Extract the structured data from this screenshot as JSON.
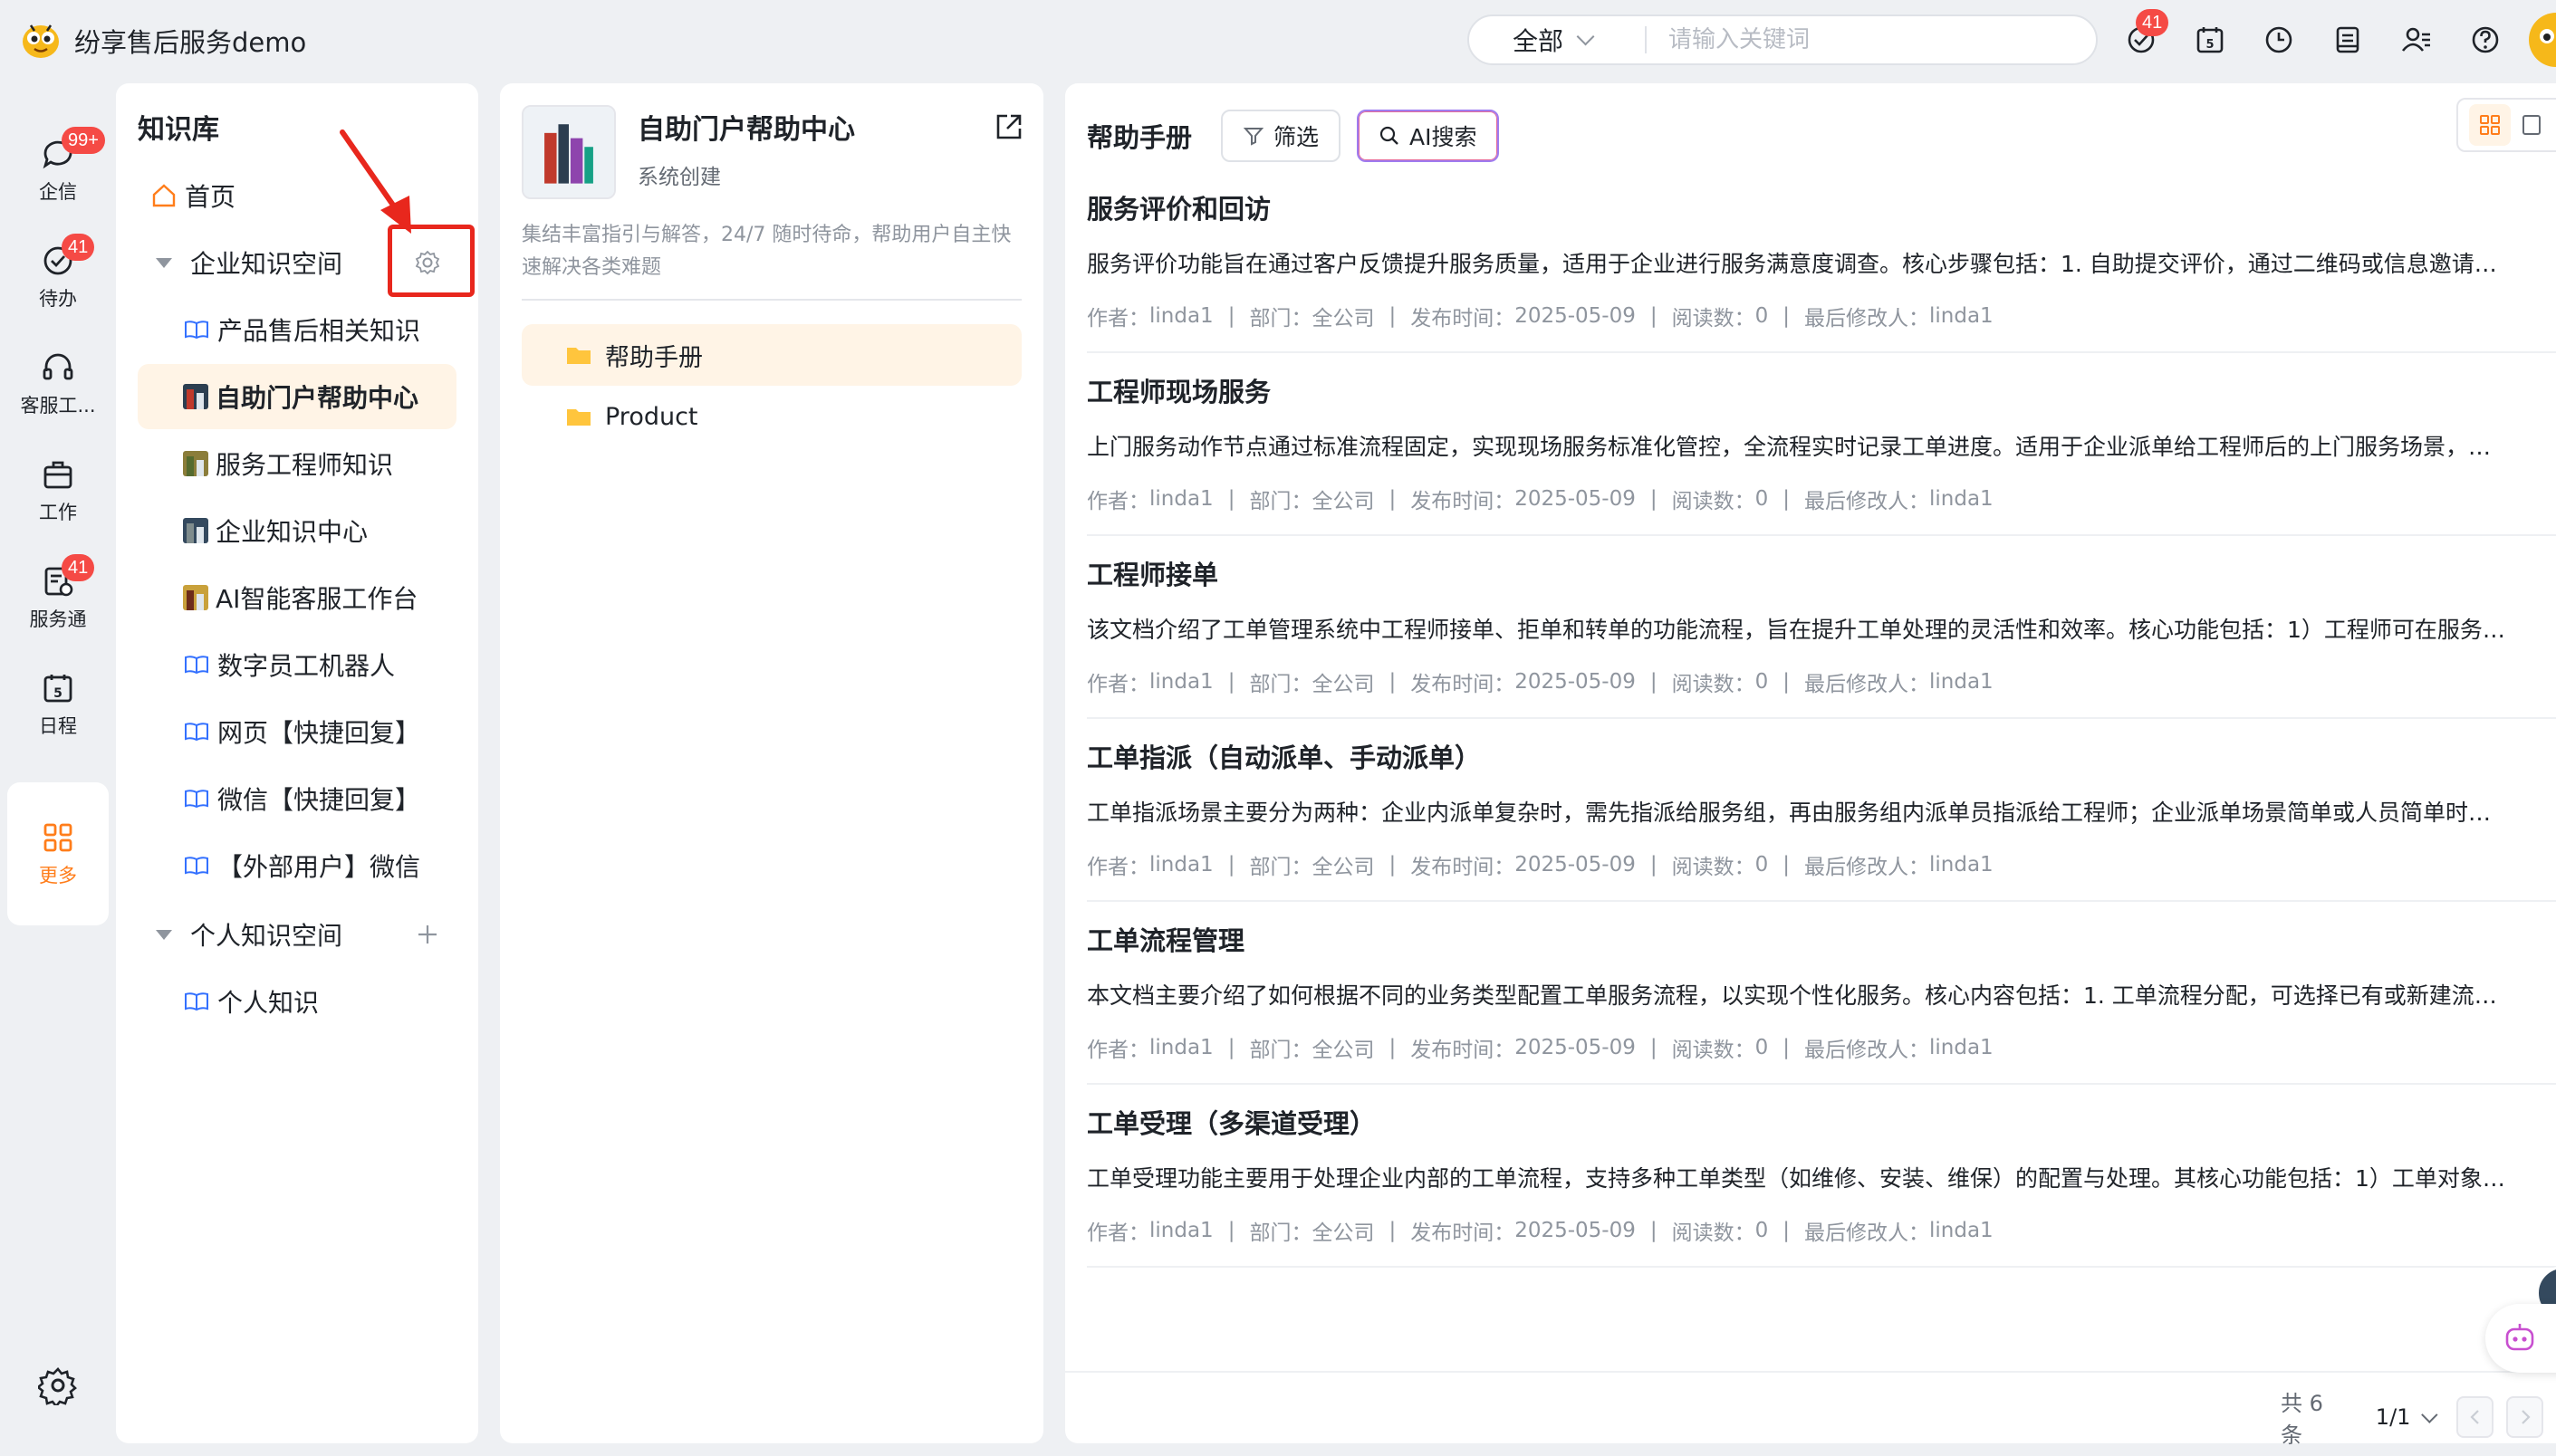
{
  "app": {
    "title": "纷享售后服务demo"
  },
  "search": {
    "scope": "全部",
    "placeholder": "请输入关键词"
  },
  "top_icons": [
    {
      "name": "todo-check-icon",
      "badge": "41"
    },
    {
      "name": "calendar-icon",
      "label": "5"
    },
    {
      "name": "clock-icon"
    },
    {
      "name": "report-icon"
    },
    {
      "name": "contacts-icon"
    },
    {
      "name": "help-icon"
    }
  ],
  "rail": {
    "items": [
      {
        "id": "qixin",
        "label": "企信",
        "badge": "99+"
      },
      {
        "id": "todo",
        "label": "待办",
        "badge": "41"
      },
      {
        "id": "service-desk",
        "label": "客服工..."
      },
      {
        "id": "work",
        "label": "工作"
      },
      {
        "id": "service-pass",
        "label": "服务通",
        "badge": "41"
      },
      {
        "id": "schedule",
        "label": "日程",
        "calendar_day": "5"
      },
      {
        "id": "more",
        "label": "更多"
      }
    ]
  },
  "tree": {
    "title": "知识库",
    "home": "首页",
    "enterprise_space": "企业知识空间",
    "enterprise_items": [
      "产品售后相关知识",
      "自助门户帮助中心",
      "服务工程师知识",
      "企业知识中心",
      "AI智能客服工作台",
      "数字员工机器人",
      "网页【快捷回复】",
      "微信【快捷回复】",
      "【外部用户】微信"
    ],
    "personal_space": "个人知识空间",
    "personal_items": [
      "个人知识"
    ]
  },
  "space": {
    "name": "自助门户帮助中心",
    "creator": "系统创建",
    "description": "集结丰富指引与解答，24/7 随时待命，帮助用户自主快速解决各类难题",
    "folders": [
      "帮助手册",
      "Product"
    ]
  },
  "docs": {
    "title": "帮助手册",
    "filter_label": "筛选",
    "ai_search_label": "AI搜索",
    "meta_labels": {
      "author": "作者：",
      "dept": "部门：",
      "published": "发布时间：",
      "reads": "阅读数：",
      "modifier": "最后修改人："
    },
    "items": [
      {
        "title": "服务评价和回访",
        "summary": "服务评价功能旨在通过客户反馈提升服务质量，适用于企业进行服务满意度调查。核心步骤包括：1. 自助提交评价，通过二维码或信息邀请…",
        "author": "linda1",
        "dept": "全公司",
        "published": "2025-05-09",
        "reads": "0",
        "modifier": "linda1"
      },
      {
        "title": "工程师现场服务",
        "summary": "上门服务动作节点通过标准流程固定，实现现场服务标准化管控，全流程实时记录工单进度。适用于企业派单给工程师后的上门服务场景，…",
        "author": "linda1",
        "dept": "全公司",
        "published": "2025-05-09",
        "reads": "0",
        "modifier": "linda1"
      },
      {
        "title": "工程师接单",
        "summary": "该文档介绍了工单管理系统中工程师接单、拒单和转单的功能流程，旨在提升工单处理的灵活性和效率。核心功能包括：1）工程师可在服务…",
        "author": "linda1",
        "dept": "全公司",
        "published": "2025-05-09",
        "reads": "0",
        "modifier": "linda1"
      },
      {
        "title": "工单指派（自动派单、手动派单）",
        "summary": "工单指派场景主要分为两种：企业内派单复杂时，需先指派给服务组，再由服务组内派单员指派给工程师；企业派单场景简单或人员简单时…",
        "author": "linda1",
        "dept": "全公司",
        "published": "2025-05-09",
        "reads": "0",
        "modifier": "linda1"
      },
      {
        "title": "工单流程管理",
        "summary": "本文档主要介绍了如何根据不同的业务类型配置工单服务流程，以实现个性化服务。核心内容包括：1. 工单流程分配，可选择已有或新建流…",
        "author": "linda1",
        "dept": "全公司",
        "published": "2025-05-09",
        "reads": "0",
        "modifier": "linda1"
      },
      {
        "title": "工单受理（多渠道受理）",
        "summary": "工单受理功能主要用于处理企业内部的工单流程，支持多种工单类型（如维修、安装、维保）的配置与处理。其核心功能包括：1）工单对象…",
        "author": "linda1",
        "dept": "全公司",
        "published": "2025-05-09",
        "reads": "0",
        "modifier": "linda1"
      }
    ],
    "pager": {
      "total": "共 6 条",
      "page": "1/1"
    }
  },
  "colors": {
    "accent": "#ff7d1a",
    "active_bg": "#fff4e6",
    "badge": "#f54a45",
    "annotation_red": "#e8271d"
  }
}
